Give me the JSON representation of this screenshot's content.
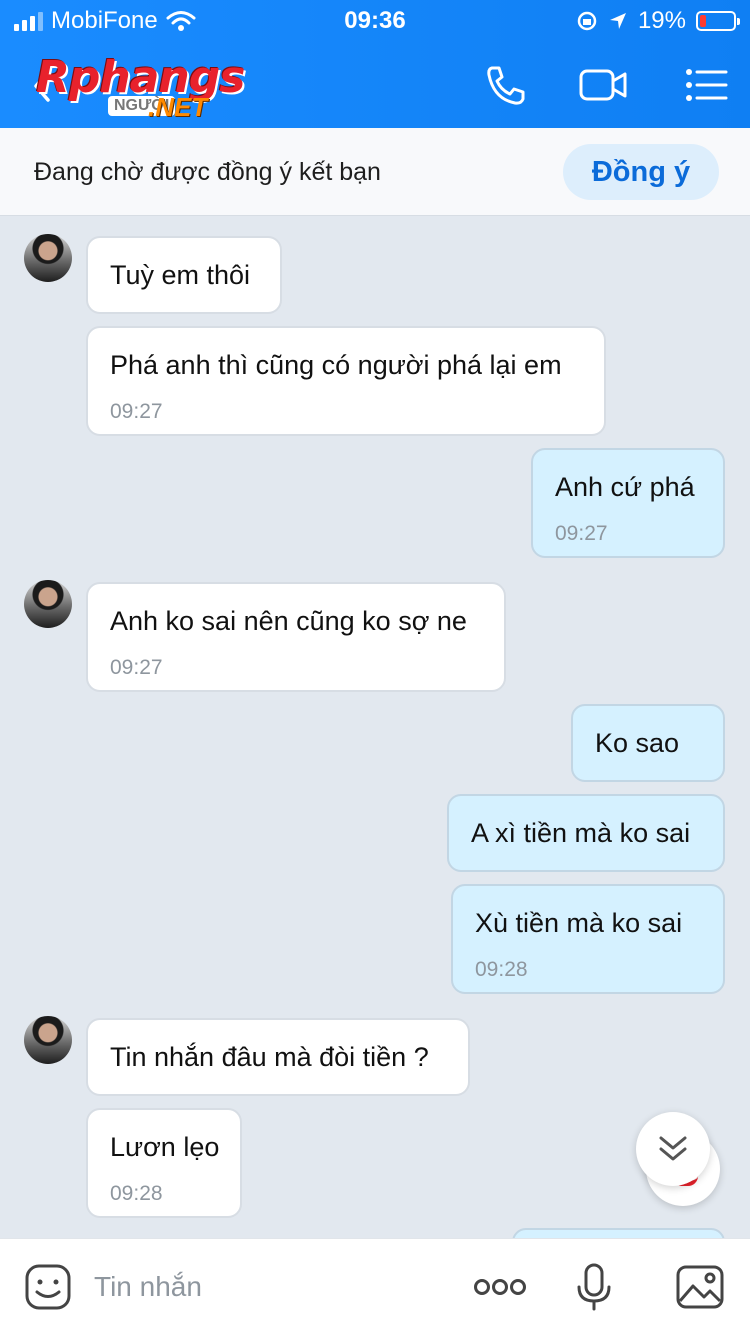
{
  "status_bar": {
    "carrier": "MobiFone",
    "time": "09:36",
    "battery": "19%",
    "battery_level": 0.19
  },
  "header": {
    "logo_main": "Rphangs",
    "logo_sub": "NGƯỜI",
    "logo_net": ".NET",
    "icons": [
      "back-icon",
      "phone-icon",
      "video-camera-icon",
      "menu-icon"
    ]
  },
  "friend_banner": {
    "text": "Đang chờ được đồng ý kết bạn",
    "accept_label": "Đồng ý"
  },
  "messages": [
    {
      "side": "in",
      "text": "Tuỳ em thôi",
      "time": ""
    },
    {
      "side": "in",
      "text": "Phá anh thì cũng có người phá lại em",
      "time": "09:27"
    },
    {
      "side": "out",
      "text": "Anh cứ phá",
      "time": "09:27"
    },
    {
      "side": "in",
      "text": "Anh ko sai nên cũng ko sợ ne",
      "time": "09:27"
    },
    {
      "side": "out",
      "text": "Ko sao",
      "time": ""
    },
    {
      "side": "out",
      "text": "A xì tiền mà ko sai",
      "time": ""
    },
    {
      "side": "out",
      "text": "Xù tiền mà ko sai",
      "time": "09:28"
    },
    {
      "side": "in",
      "text": "Tin nhắn đâu mà đòi tiền ?",
      "time": ""
    },
    {
      "side": "in",
      "text": "Lươn lẹo",
      "time": "09:28"
    }
  ],
  "input_bar": {
    "placeholder": "Tin nhắn"
  },
  "colors": {
    "header": "#1a8cff",
    "incoming_bubble": "#ffffff",
    "outgoing_bubble": "#d5f1ff",
    "accept_button": "#ddeefc",
    "accept_text": "#0b6bd9",
    "background": "#e2e8ef"
  }
}
